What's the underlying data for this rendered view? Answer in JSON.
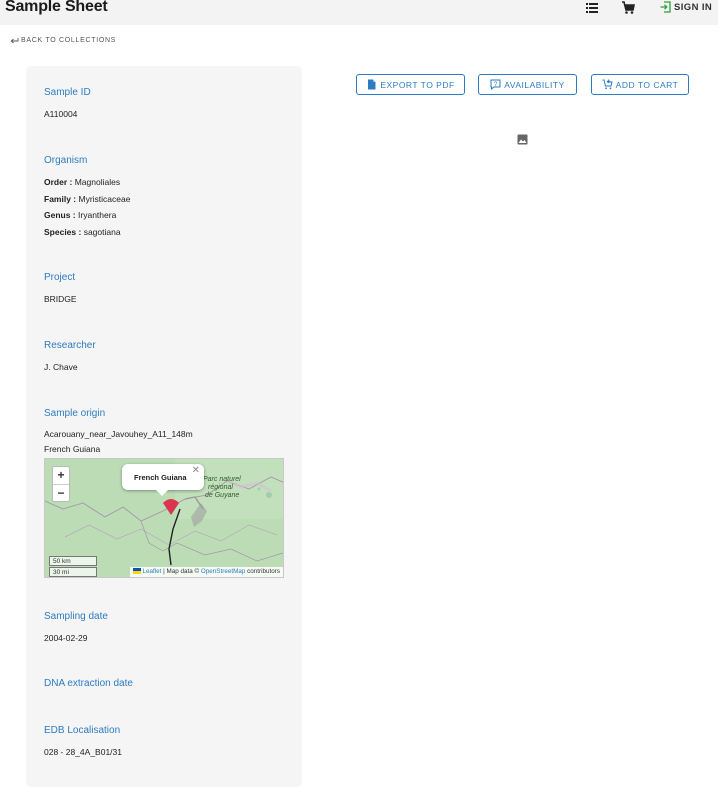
{
  "header": {
    "title": "Sample Sheet",
    "signin_label": "SIGN IN",
    "icons": [
      "list-icon",
      "cart-icon",
      "login-icon"
    ]
  },
  "back_link": {
    "label": "BACK TO COLLECTIONS"
  },
  "actions": {
    "export_label": "EXPORT TO PDF",
    "availability_label": "AVAILABILITY",
    "cart_label": "ADD TO CART"
  },
  "sample": {
    "id_title": "Sample ID",
    "id_value": "A110004",
    "organism_title": "Organism",
    "organism": {
      "order_label": "Order :",
      "order": "Magnoliales",
      "family_label": "Family :",
      "family": "Myristicaceae",
      "genus_label": "Genus :",
      "genus": "Iryanthera",
      "species_label": "Species :",
      "species": "sagotiana"
    },
    "project_title": "Project",
    "project_value": "BRIDGE",
    "researcher_title": "Researcher",
    "researcher_value": "J. Chave",
    "origin_title": "Sample origin",
    "origin_site": "Acarouany_near_Javouhey_A11_148m",
    "origin_country": "French Guiana",
    "sampling_date_title": "Sampling date",
    "sampling_date_value": "2004-02-29",
    "dna_title": "DNA extraction date",
    "edb_title": "EDB Localisation",
    "edb_value": "028 - 28_4A_B01/31"
  },
  "map": {
    "popup_text": "French Guiana",
    "zoom_in": "+",
    "zoom_out": "−",
    "scale_km": "50 km",
    "scale_mi": "30 mi",
    "park_label_1": "Parc naturel",
    "park_label_2": "régional",
    "park_label_3": "de Guyane",
    "attr_leaflet": "Leaflet",
    "attr_mid": "| Map data ©",
    "attr_osm": "OpenStreetMap",
    "attr_end": "contributors"
  },
  "colors": {
    "accent": "#2d7cc2",
    "card_bg": "#f5f5f5",
    "topbar_bg": "#f3f3f3",
    "marker": "#d9364f",
    "signin_icon": "#2e9e3e"
  }
}
